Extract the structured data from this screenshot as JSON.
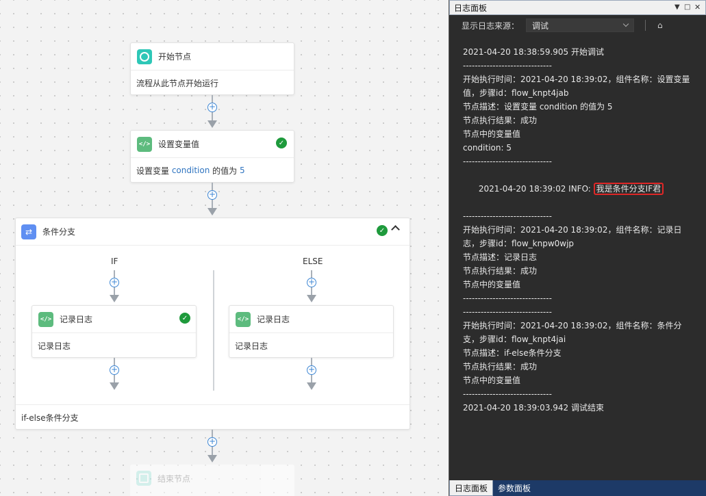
{
  "canvas": {
    "start_node": {
      "title": "开始节点",
      "desc": "流程从此节点开始运行"
    },
    "set_var_node": {
      "title": "设置变量值",
      "desc_prefix": "设置变量 ",
      "desc_var": "condition",
      "desc_mid": " 的值为 ",
      "desc_value": "5"
    },
    "branch_node": {
      "title": "条件分支",
      "if_label": "IF",
      "else_label": "ELSE",
      "if_child": {
        "title": "记录日志",
        "desc": "记录日志"
      },
      "else_child": {
        "title": "记录日志",
        "desc": "记录日志"
      },
      "footer": "if-else条件分支"
    },
    "end_node": {
      "title": "结束节点"
    },
    "icons": {
      "start": "circle-icon",
      "code": "code-icon",
      "branch": "branch-icon",
      "check": "check-circle-icon",
      "add": "plus-circle-icon"
    },
    "colors": {
      "check": "#1e9a3c",
      "start": "#2ec7b7",
      "code": "#5dbb7e",
      "branch": "#5f8ff2",
      "link": "#2f74c0"
    }
  },
  "panel": {
    "title": "日志面板",
    "source_label": "显示日志来源：",
    "source_value": "调试",
    "log_lines": [
      "2021-04-20 18:38:59.905 开始调试",
      "------------------------------",
      "开始执行时间：2021-04-20 18:39:02，组件名称：设置变量值，步骤id：flow_knpt4jab",
      "节点描述：设置变量 condition 的值为 5",
      "节点执行结果：成功",
      "节点中的变量值",
      "condition: 5",
      "------------------------------"
    ],
    "highlight_line": {
      "prefix": "2021-04-20 18:39:02 INFO: ",
      "highlight": "我是条件分支IF君"
    },
    "log_lines_2": [
      "------------------------------",
      "开始执行时间：2021-04-20 18:39:02，组件名称：记录日志，步骤id：flow_knpw0wjp",
      "节点描述：记录日志",
      "节点执行结果：成功",
      "节点中的变量值",
      "------------------------------",
      "------------------------------",
      "开始执行时间：2021-04-20 18:39:02，组件名称：条件分支，步骤id：flow_knpt4jai",
      "节点描述：if-else条件分支",
      "节点执行结果：成功",
      "节点中的变量值",
      "------------------------------",
      "2021-04-20 18:39:03.942 调试结束"
    ],
    "tabs": [
      {
        "label": "日志面板",
        "active": true
      },
      {
        "label": "参数面板",
        "active": false
      }
    ],
    "highlight_color": "#e02727"
  }
}
